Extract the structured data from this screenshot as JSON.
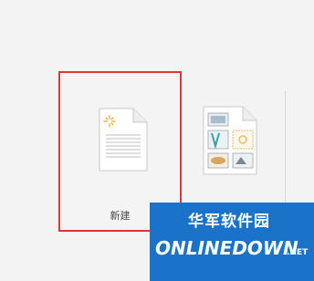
{
  "new_tile": {
    "label": "新建"
  },
  "watermark": {
    "cn_text": "华军软件园",
    "en_text": "ONLINEDOWN",
    "tld_text": ".NET"
  },
  "colors": {
    "selection_border": "#d9383a",
    "watermark_bg": "#1a73c8"
  }
}
